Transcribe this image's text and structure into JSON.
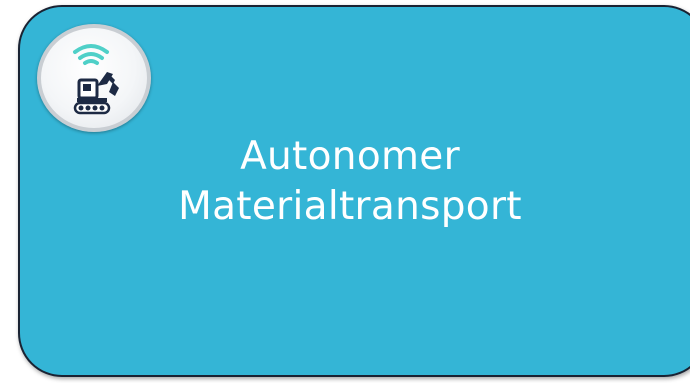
{
  "card": {
    "title_line1": "Autonomer",
    "title_line2": "Materialtransport",
    "background_color": "#34b5d6",
    "border_color": "#1a2333"
  },
  "badge": {
    "icon": "autonomous-excavator-icon",
    "wifi_color": "#4fd0c8",
    "machine_color": "#1d2a44"
  }
}
